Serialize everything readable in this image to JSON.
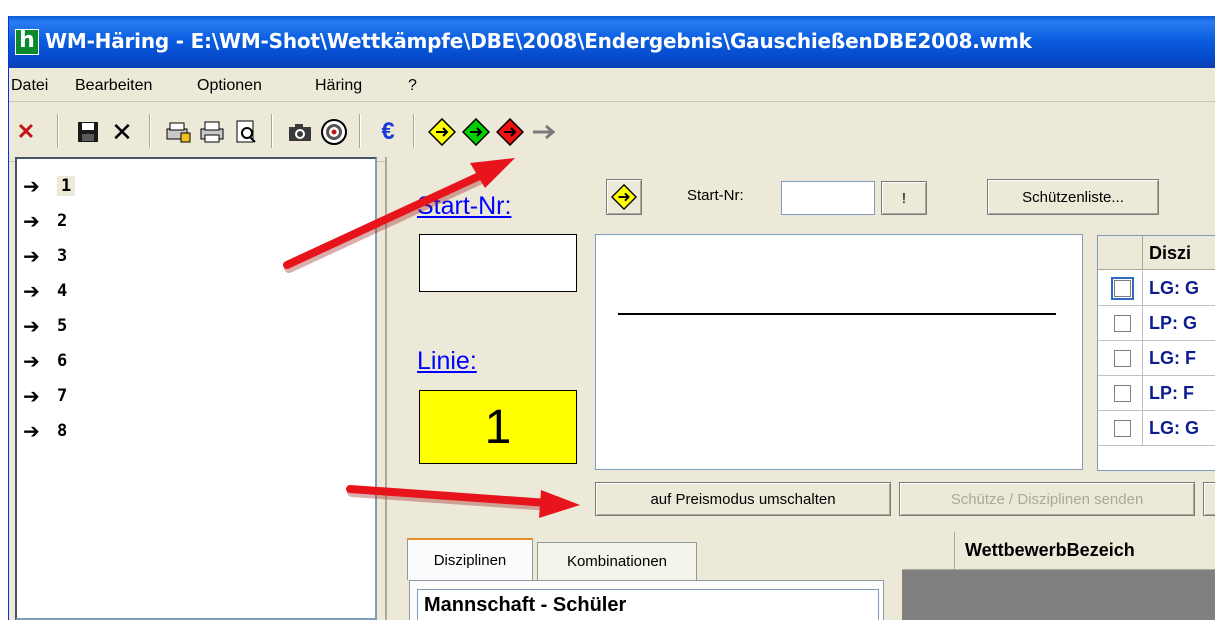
{
  "window": {
    "title": "WM-Häring - E:\\WM-Shot\\Wettkämpfe\\DBE\\2008\\Endergebnis\\GauschießenDBE2008.wmk",
    "app_icon_letter": "h"
  },
  "menu": {
    "items": [
      {
        "label": "Datei"
      },
      {
        "label": "Bearbeiten"
      },
      {
        "label": "Optionen"
      },
      {
        "label": "Häring"
      },
      {
        "label": "?"
      }
    ]
  },
  "toolbar": {
    "icons": [
      "close-red-x-icon",
      "save-disk-icon",
      "cancel-x-icon",
      "print-setup-icon",
      "printer-icon",
      "print-preview-icon",
      "camera-icon",
      "target-icon",
      "euro-icon",
      "yellow-diamond-arrow-icon",
      "green-diamond-arrow-icon",
      "red-diamond-arrow-icon",
      "gray-arrow-icon"
    ],
    "euro_glyph": "€"
  },
  "tree": {
    "items": [
      "1",
      "2",
      "3",
      "4",
      "5",
      "6",
      "7",
      "8"
    ]
  },
  "form": {
    "start_nr_label": "Start-Nr:",
    "start_nr_value": "",
    "linie_label": "Linie:",
    "linie_value": "1",
    "start_nr_small_label": "Start-Nr:",
    "start_nr_small_value": "",
    "exclaim_button": "!",
    "schuetzenliste_button": "Schützenliste...",
    "preismodus_button": "auf Preismodus umschalten",
    "senden_button": "Schütze / Disziplinen senden"
  },
  "disziplin_grid": {
    "header": "Diszi",
    "rows": [
      "LG: G",
      "LP: G",
      "LG: F",
      "LP: F",
      "LG: G"
    ]
  },
  "tabs": {
    "items": [
      "Disziplinen",
      "Kombinationen"
    ],
    "list_first_item": "Mannschaft - Schüler"
  },
  "wettbewerb_grid": {
    "header": "WettbewerbBezeich"
  },
  "colors": {
    "title_blue": "#0b5ee0",
    "linie_yellow": "#ffff00",
    "link_blue": "#0000ff",
    "annotation_red": "#e8141b"
  }
}
